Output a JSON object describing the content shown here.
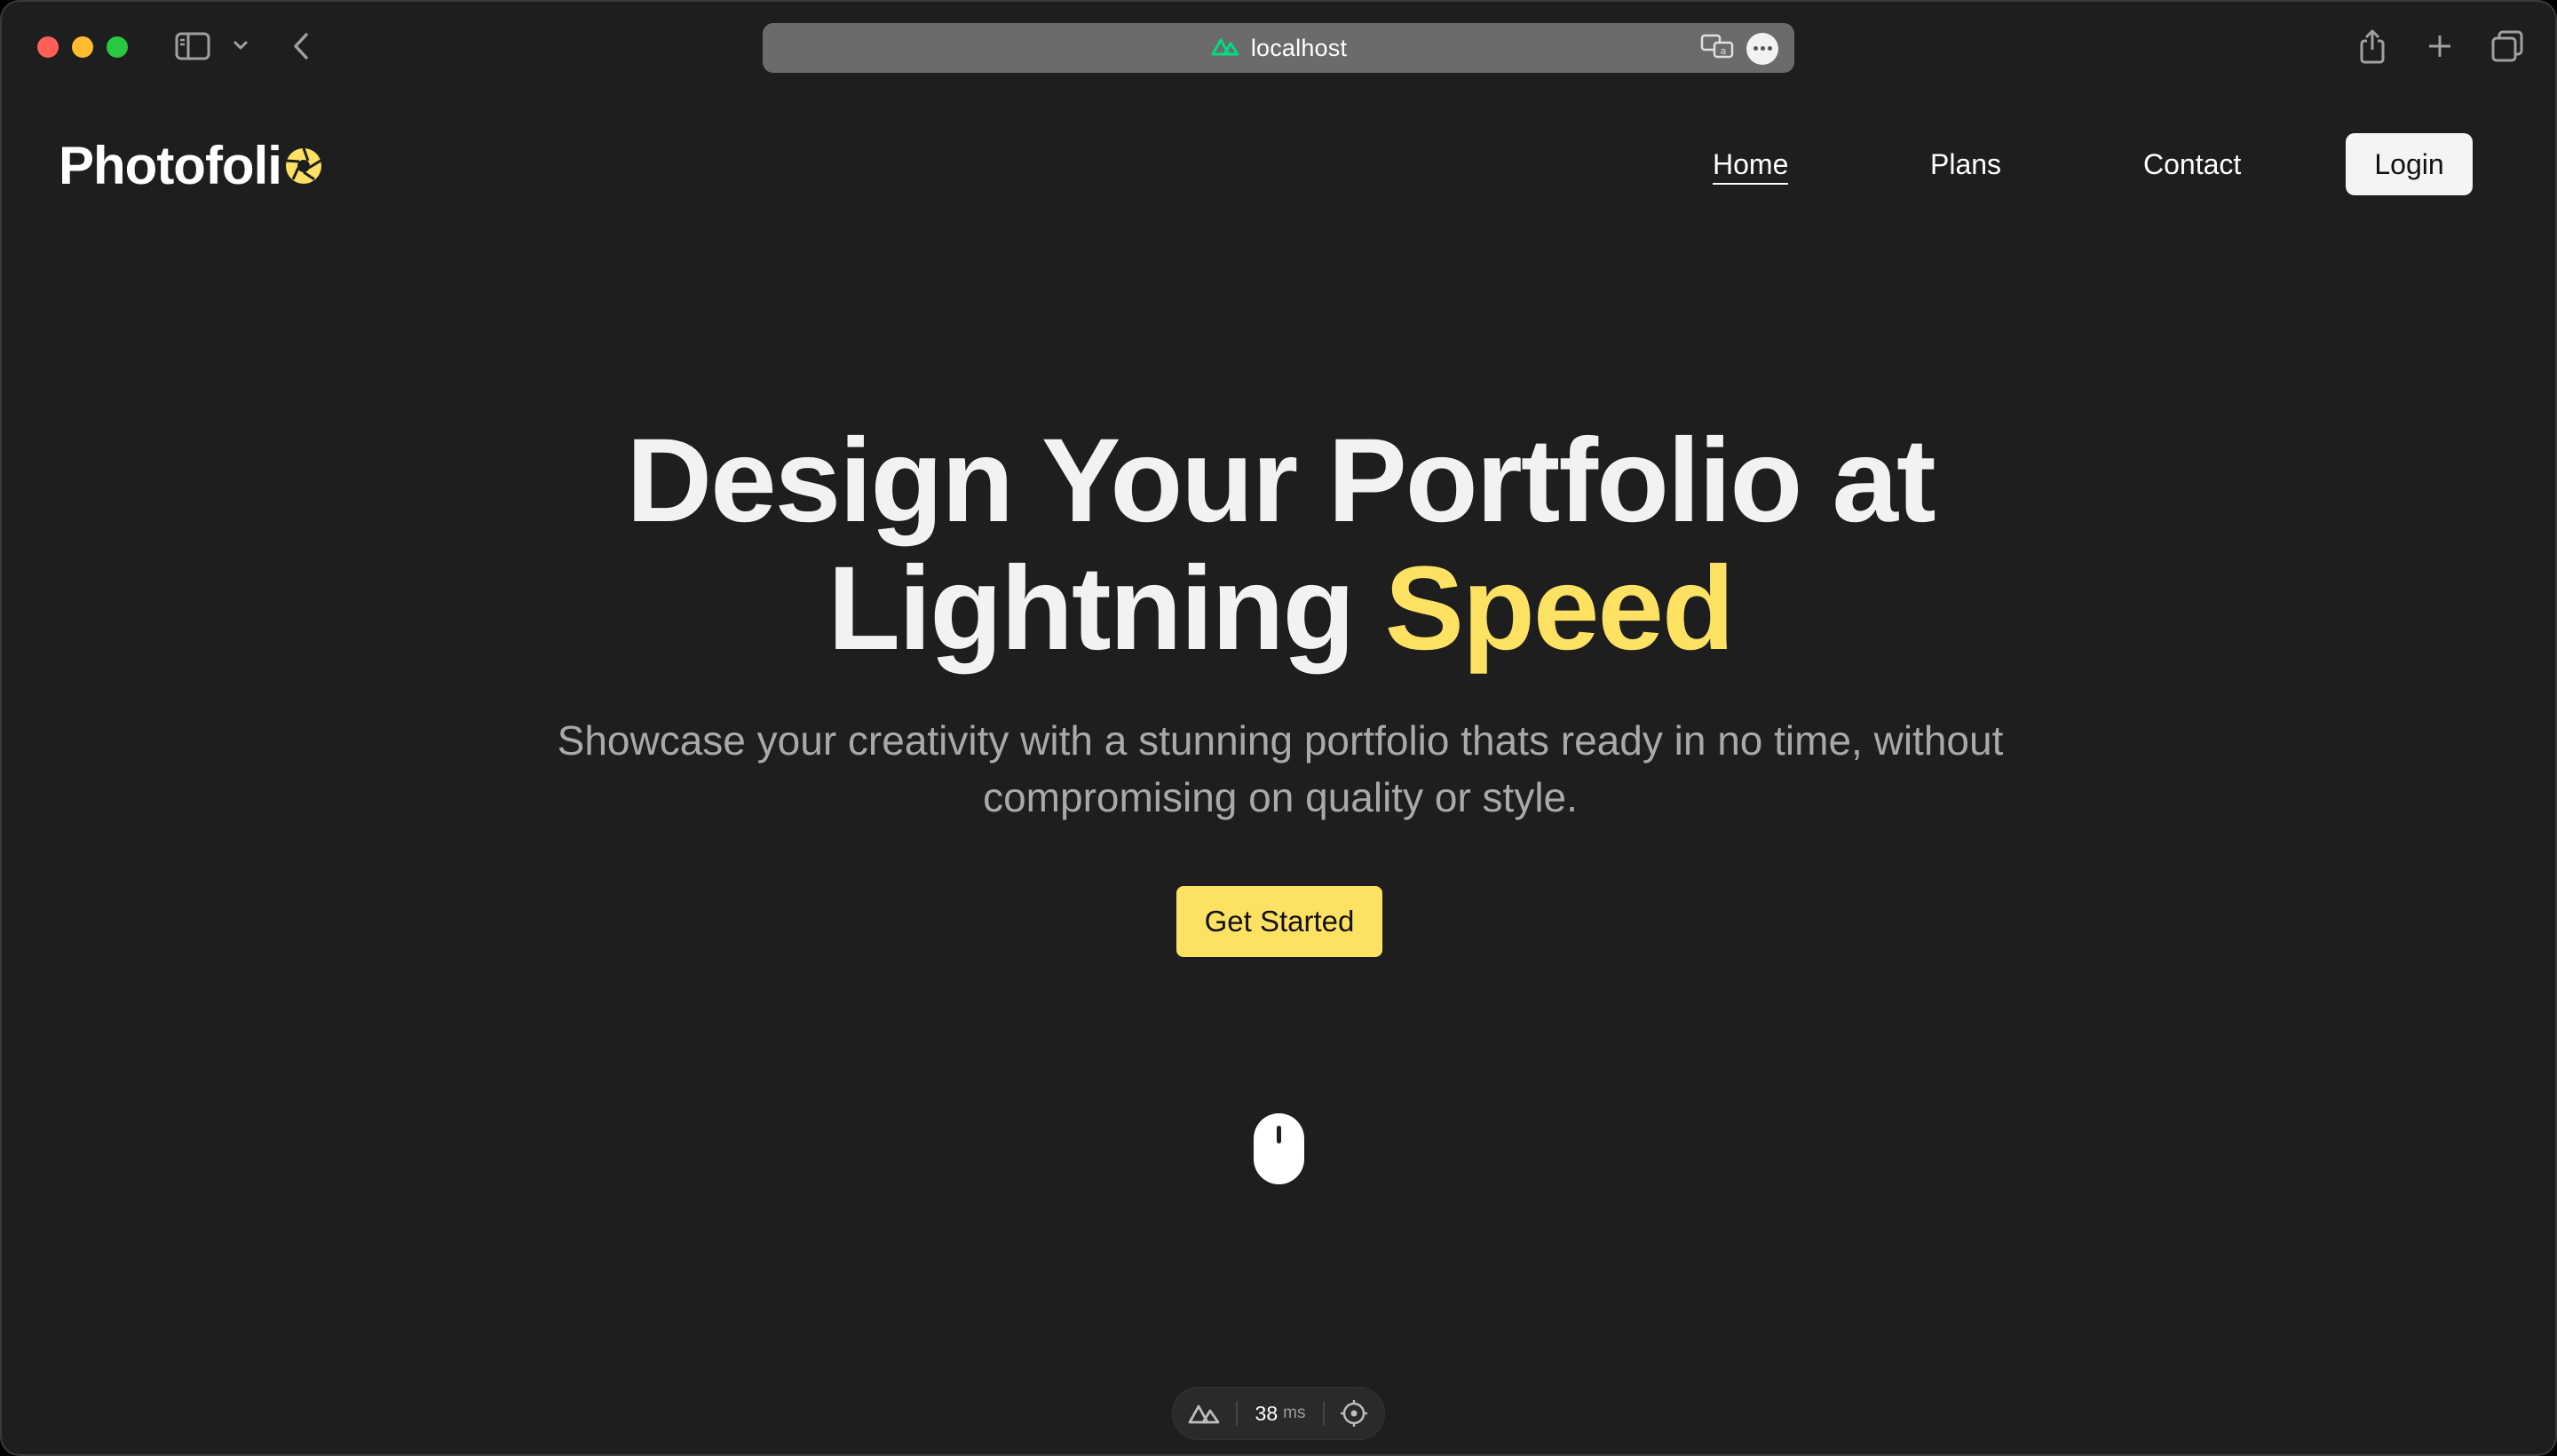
{
  "browser": {
    "url": "localhost",
    "colors": {
      "chrome": "#1e1e1e",
      "urlbar": "#6b6b6b",
      "nuxt_green": "#00dc82"
    }
  },
  "site": {
    "logo_text": "Photofoli",
    "nav": {
      "home": "Home",
      "plans": "Plans",
      "contact": "Contact",
      "login": "Login"
    },
    "hero": {
      "title_line1": "Design Your Portfolio at",
      "title_line2_plain": "Lightning",
      "title_line2_accent": "Speed",
      "subtitle_line1": "Showcase your creativity with a stunning portfolio thats ready in no time, without",
      "subtitle_line2": "compromising on quality or style.",
      "cta": "Get Started"
    },
    "colors": {
      "accent": "#fde163",
      "background": "#1e1e1e",
      "text": "#f2f2f2",
      "muted": "#a9a9a9"
    }
  },
  "devtools": {
    "render_time": "38",
    "render_unit": "ms"
  }
}
